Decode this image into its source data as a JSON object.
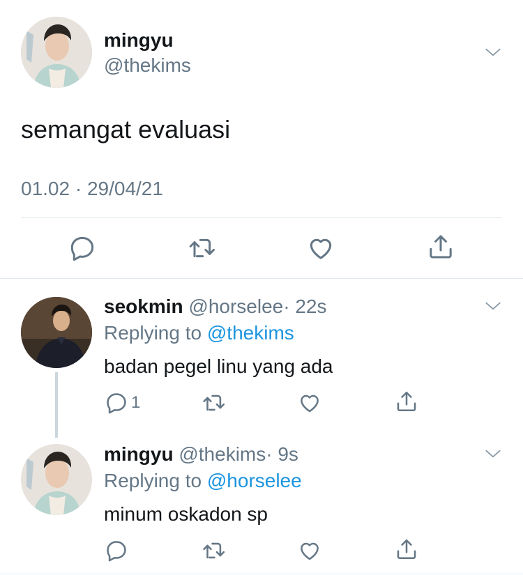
{
  "main_tweet": {
    "display_name": "mingyu",
    "handle": "@thekims",
    "text": "semangat evaluasi",
    "timestamp": "01.02 · 29/04/21"
  },
  "replies": [
    {
      "display_name": "seokmin",
      "handle": "@horselee",
      "time": "· 22s",
      "replying_label": "Replying to",
      "replying_to": "@thekims",
      "text": "badan pegel linu yang ada",
      "reply_count": "1"
    },
    {
      "display_name": "mingyu",
      "handle": "@thekims",
      "time": "· 9s",
      "replying_label": "Replying to",
      "replying_to": "@horselee",
      "text": "minum oskadon sp"
    }
  ],
  "colors": {
    "text": "#14171a",
    "secondary": "#657786",
    "link": "#1b95e0",
    "divider": "#e1e8ed"
  },
  "icons": [
    "chevron-down-icon",
    "reply-icon",
    "retweet-icon",
    "like-icon",
    "share-icon"
  ]
}
